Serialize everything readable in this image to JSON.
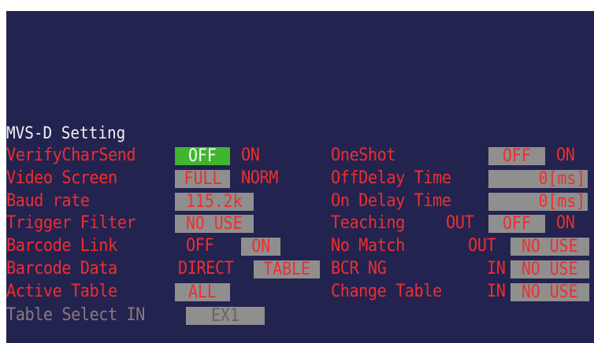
{
  "title": "MVS-D Setting",
  "left": {
    "verify_char_send": {
      "label": "VerifyCharSend",
      "off": "OFF",
      "on": "ON"
    },
    "video_screen": {
      "label": "Video Screen",
      "full": "FULL",
      "norm": "NORM"
    },
    "baud_rate": {
      "label": "Baud rate",
      "value": "115.2k"
    },
    "trigger_filter": {
      "label": "Trigger Filter",
      "value": "NO USE"
    },
    "barcode_link": {
      "label": "Barcode Link",
      "off": "OFF",
      "on": "ON"
    },
    "barcode_data": {
      "label": "Barcode Data",
      "direct": "DIRECT",
      "table": "TABLE"
    },
    "active_table": {
      "label": "Active Table",
      "value": "ALL"
    },
    "table_select_in": {
      "label": "Table Select IN",
      "value": "EX1"
    }
  },
  "right": {
    "one_shot": {
      "label": "OneShot",
      "off": "OFF",
      "on": "ON"
    },
    "off_delay_time": {
      "label": "OffDelay Time",
      "value": "0[ms]"
    },
    "on_delay_time": {
      "label": "On Delay Time",
      "value": "0[ms]"
    },
    "teaching": {
      "label": "Teaching",
      "io": "OUT",
      "off": "OFF",
      "on": "ON"
    },
    "no_match": {
      "label": "No Match",
      "io": "OUT",
      "value": "NO USE"
    },
    "bcr_ng": {
      "label": "BCR NG",
      "io": "IN",
      "value": "NO USE"
    },
    "change_table": {
      "label": "Change Table",
      "io": "IN",
      "value": "NO USE"
    }
  },
  "colors": {
    "background": "#232350",
    "label_red": "#ee2e2e",
    "selected_green": "#3fb530",
    "field_gray": "#8f8f8f",
    "disabled_text": "#8a7a7a",
    "title_white": "#f2f2f2"
  }
}
